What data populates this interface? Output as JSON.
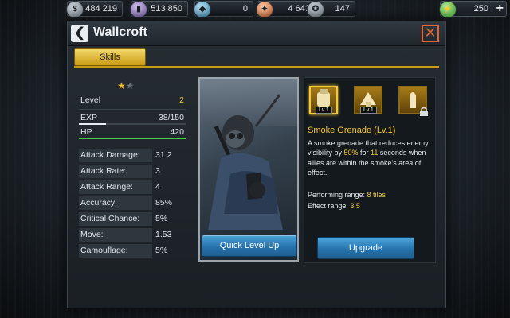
{
  "resources": [
    {
      "icon": "gold-icon",
      "value": "484 219"
    },
    {
      "icon": "oil-barrel-icon",
      "value": "513 850"
    },
    {
      "icon": "diamond-icon",
      "value": "0"
    },
    {
      "icon": "compass-icon",
      "value": "4 643"
    },
    {
      "icon": "medal-icon",
      "value": "147"
    },
    {
      "icon": "energy-icon",
      "value": "250"
    }
  ],
  "header": {
    "title": "Wallcroft"
  },
  "tabs": [
    {
      "label": "Skills"
    }
  ],
  "unit": {
    "stars_filled": 1,
    "stars_total": 2,
    "level_label": "Level",
    "level_value": "2",
    "exp_label": "EXP",
    "exp_value": "38/150",
    "exp_fraction": 0.253,
    "hp_label": "HP",
    "hp_value": "420",
    "hp_fraction": 1.0
  },
  "attributes": [
    {
      "label": "Attack Damage:",
      "value": "31.2"
    },
    {
      "label": "Attack Rate:",
      "value": "3"
    },
    {
      "label": "Attack Range:",
      "value": "4"
    },
    {
      "label": "Accuracy:",
      "value": "85%"
    },
    {
      "label": "Critical Chance:",
      "value": "5%"
    },
    {
      "label": "Move:",
      "value": "1.53"
    },
    {
      "label": "Camouflage:",
      "value": "5%"
    }
  ],
  "buttons": {
    "quick_level_up": "Quick Level Up",
    "upgrade": "Upgrade"
  },
  "skill_slots": [
    {
      "icon": "grenade-skill-icon",
      "level": "Lv.1",
      "selected": true,
      "locked": false
    },
    {
      "icon": "fire-skill-icon",
      "level": "Lv.1",
      "selected": false,
      "locked": false
    },
    {
      "icon": "bullet-skill-icon",
      "level": "",
      "selected": false,
      "locked": true
    }
  ],
  "skill": {
    "name": "Smoke Grenade (Lv.1)",
    "desc_1": "A smoke grenade that reduces enemy visibility by ",
    "desc_pct": "50%",
    "desc_2": " for ",
    "desc_secs": "11",
    "desc_3": " seconds when allies are within the smoke's area of effect.",
    "range_label": "Performing range: ",
    "range_value": "8 tiles",
    "effect_label": "Effect range: ",
    "effect_value": "3.5"
  },
  "colors": {
    "accent_gold": "#f3c93a",
    "button_blue": "#2673ad",
    "hp_green": "#3fd43f"
  }
}
